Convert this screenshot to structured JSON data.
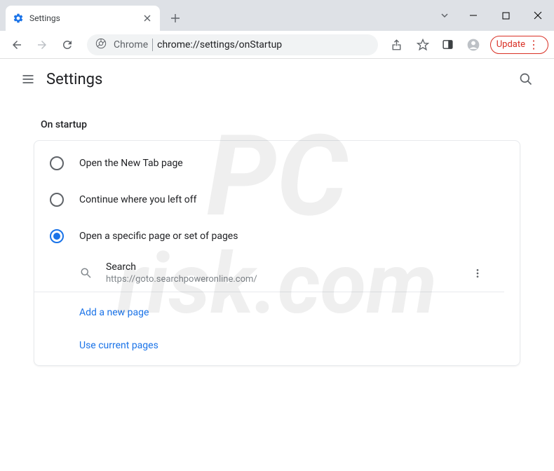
{
  "window": {
    "tab_title": "Settings"
  },
  "toolbar": {
    "url_prefix": "Chrome",
    "url_path": "chrome://settings/onStartup",
    "update_label": "Update"
  },
  "header": {
    "title": "Settings"
  },
  "section": {
    "title": "On startup",
    "options": [
      {
        "label": "Open the New Tab page",
        "selected": false
      },
      {
        "label": "Continue where you left off",
        "selected": false
      },
      {
        "label": "Open a specific page or set of pages",
        "selected": true
      }
    ],
    "pages": [
      {
        "title": "Search",
        "url": "https://goto.searchpoweronline.com/"
      }
    ],
    "add_page_label": "Add a new page",
    "use_current_label": "Use current pages"
  }
}
